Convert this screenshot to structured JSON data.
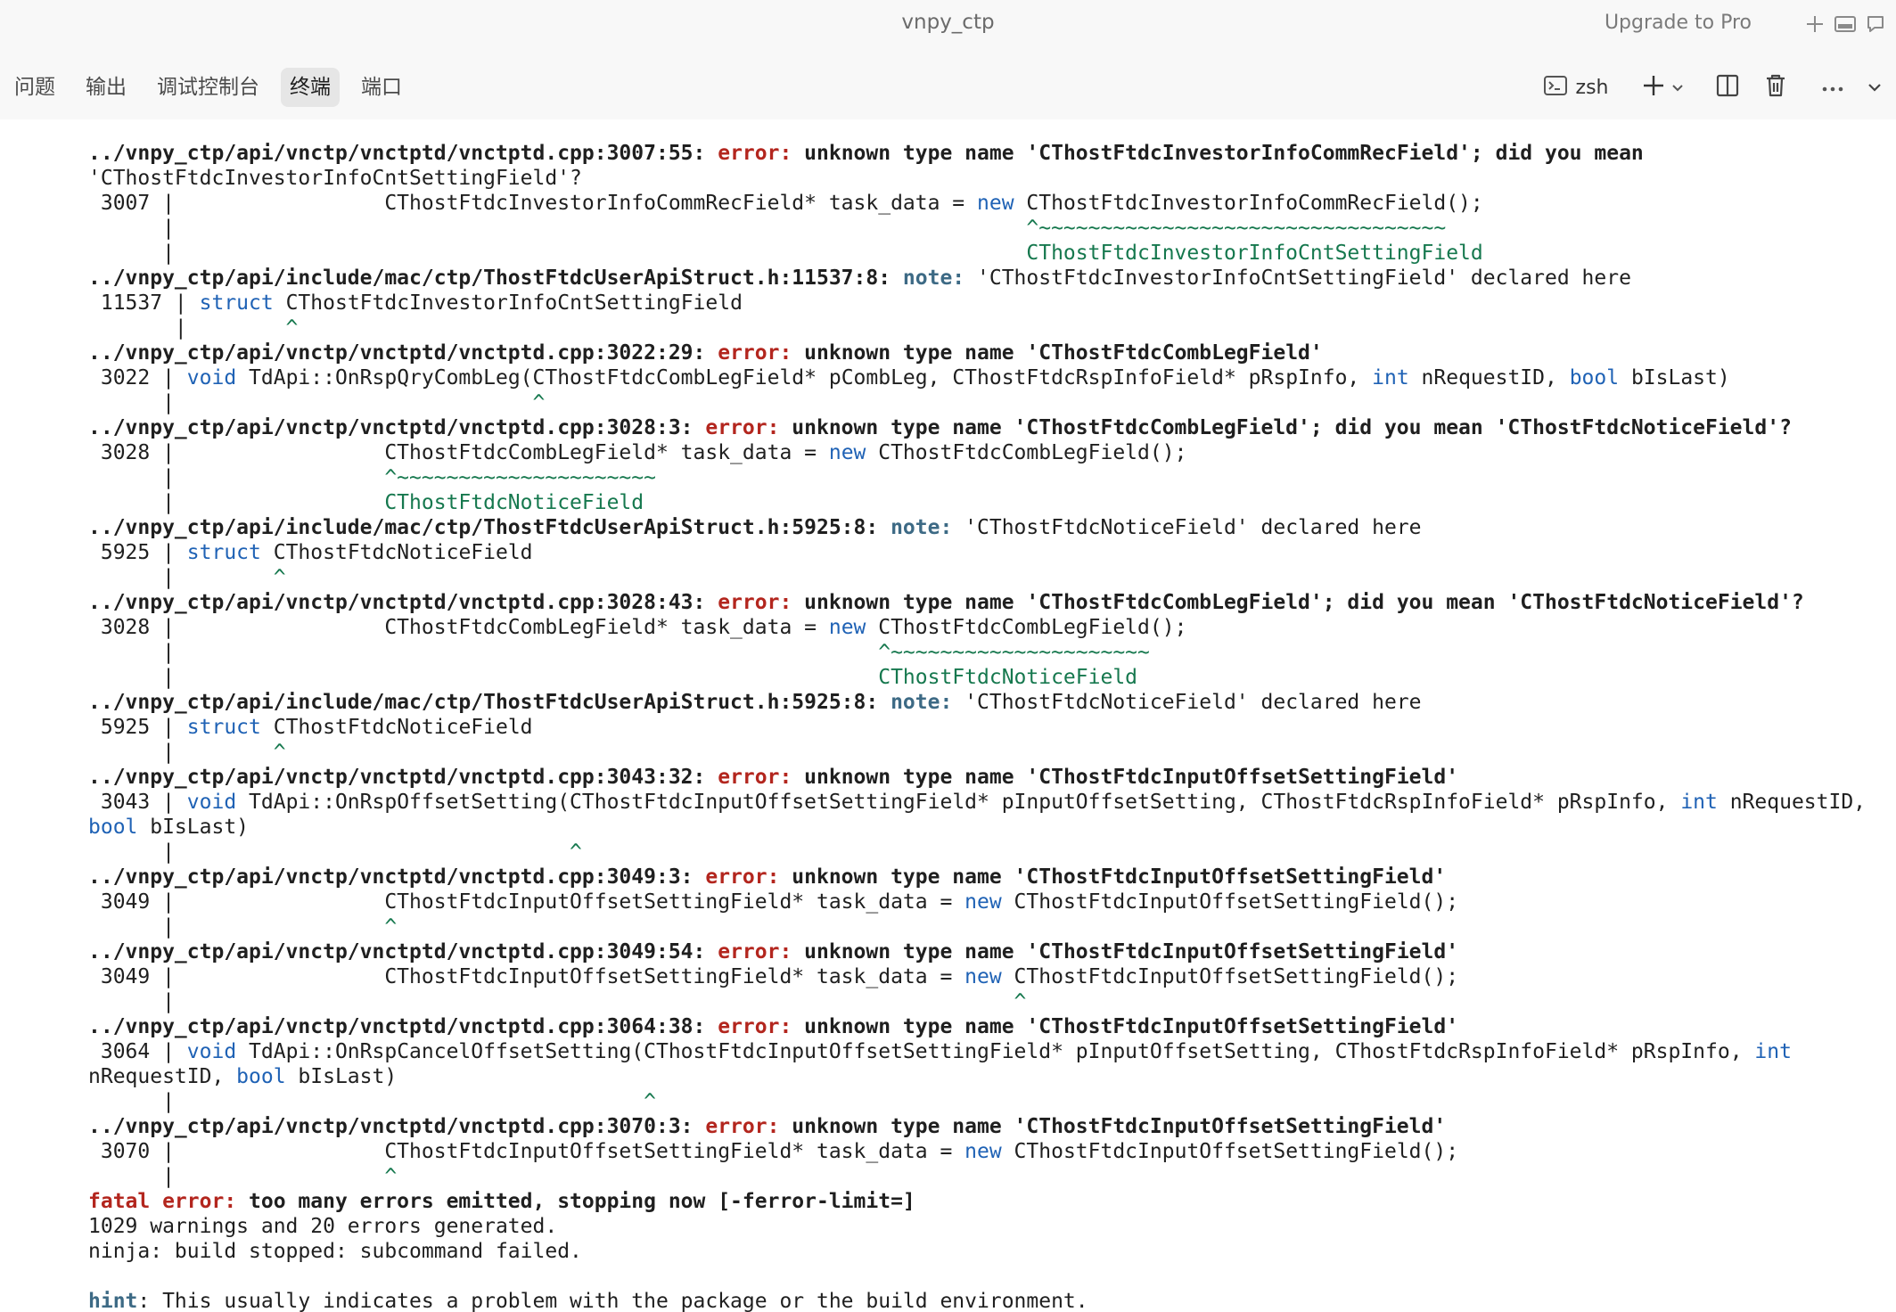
{
  "window": {
    "title": "vnpy_ctp",
    "upgrade_label": "Upgrade to Pro"
  },
  "panel": {
    "tabs": [
      {
        "label": "问题"
      },
      {
        "label": "输出"
      },
      {
        "label": "调试控制台"
      },
      {
        "label": "终端"
      },
      {
        "label": "端口"
      }
    ],
    "active_tab": "终端",
    "shell_name": "zsh"
  },
  "terminal": {
    "lines": [
      "../vnpy_ctp/api/vnctp/vnctptd/vnctptd.cpp:3007:55: error: unknown type name 'CThostFtdcInvestorInfoCommRecField'; did you mean",
      "'CThostFtdcInvestorInfoCntSettingField'?",
      " 3007 |                 CThostFtdcInvestorInfoCommRecField* task_data = new CThostFtdcInvestorInfoCommRecField();",
      "      |                                                                     ^~~~~~~~~~~~~~~~~~~~~~~~~~~~~~~~~~",
      "      |                                                                     CThostFtdcInvestorInfoCntSettingField",
      "../vnpy_ctp/api/include/mac/ctp/ThostFtdcUserApiStruct.h:11537:8: note: 'CThostFtdcInvestorInfoCntSettingField' declared here",
      " 11537 | struct CThostFtdcInvestorInfoCntSettingField",
      "       |        ^",
      "../vnpy_ctp/api/vnctp/vnctptd/vnctptd.cpp:3022:29: error: unknown type name 'CThostFtdcCombLegField'",
      " 3022 | void TdApi::OnRspQryCombLeg(CThostFtdcCombLegField* pCombLeg, CThostFtdcRspInfoField* pRspInfo, int nRequestID, bool bIsLast)",
      "      |                             ^",
      "../vnpy_ctp/api/vnctp/vnctptd/vnctptd.cpp:3028:3: error: unknown type name 'CThostFtdcCombLegField'; did you mean 'CThostFtdcNoticeField'?",
      " 3028 |                 CThostFtdcCombLegField* task_data = new CThostFtdcCombLegField();",
      "      |                 ^~~~~~~~~~~~~~~~~~~~~~",
      "      |                 CThostFtdcNoticeField",
      "../vnpy_ctp/api/include/mac/ctp/ThostFtdcUserApiStruct.h:5925:8: note: 'CThostFtdcNoticeField' declared here",
      " 5925 | struct CThostFtdcNoticeField",
      "      |        ^",
      "../vnpy_ctp/api/vnctp/vnctptd/vnctptd.cpp:3028:43: error: unknown type name 'CThostFtdcCombLegField'; did you mean 'CThostFtdcNoticeField'?",
      " 3028 |                 CThostFtdcCombLegField* task_data = new CThostFtdcCombLegField();",
      "      |                                                         ^~~~~~~~~~~~~~~~~~~~~~",
      "      |                                                         CThostFtdcNoticeField",
      "../vnpy_ctp/api/include/mac/ctp/ThostFtdcUserApiStruct.h:5925:8: note: 'CThostFtdcNoticeField' declared here",
      " 5925 | struct CThostFtdcNoticeField",
      "      |        ^",
      "../vnpy_ctp/api/vnctp/vnctptd/vnctptd.cpp:3043:32: error: unknown type name 'CThostFtdcInputOffsetSettingField'",
      " 3043 | void TdApi::OnRspOffsetSetting(CThostFtdcInputOffsetSettingField* pInputOffsetSetting, CThostFtdcRspInfoField* pRspInfo, int nRequestID,",
      "bool bIsLast)",
      "      |                                ^",
      "../vnpy_ctp/api/vnctp/vnctptd/vnctptd.cpp:3049:3: error: unknown type name 'CThostFtdcInputOffsetSettingField'",
      " 3049 |                 CThostFtdcInputOffsetSettingField* task_data = new CThostFtdcInputOffsetSettingField();",
      "      |                 ^",
      "../vnpy_ctp/api/vnctp/vnctptd/vnctptd.cpp:3049:54: error: unknown type name 'CThostFtdcInputOffsetSettingField'",
      " 3049 |                 CThostFtdcInputOffsetSettingField* task_data = new CThostFtdcInputOffsetSettingField();",
      "      |                                                                    ^",
      "../vnpy_ctp/api/vnctp/vnctptd/vnctptd.cpp:3064:38: error: unknown type name 'CThostFtdcInputOffsetSettingField'",
      " 3064 | void TdApi::OnRspCancelOffsetSetting(CThostFtdcInputOffsetSettingField* pInputOffsetSetting, CThostFtdcRspInfoField* pRspInfo, int",
      "nRequestID, bool bIsLast)",
      "      |                                      ^",
      "../vnpy_ctp/api/vnctp/vnctptd/vnctptd.cpp:3070:3: error: unknown type name 'CThostFtdcInputOffsetSettingField'",
      " 3070 |                 CThostFtdcInputOffsetSettingField* task_data = new CThostFtdcInputOffsetSettingField();",
      "      |                 ^",
      "fatal error: too many errors emitted, stopping now [-ferror-limit=]",
      "1029 warnings and 20 errors generated.",
      "ninja: build stopped: subcommand failed.",
      "",
      "hint: This usually indicates a problem with the package or the build environment."
    ]
  },
  "colors": {
    "error": "#b3261e",
    "note": "#3d6a85",
    "keyword": "#1f62b5",
    "fixit": "#16784e"
  },
  "icons": {
    "new": "plus-icon",
    "maximize": "maximize-icon",
    "chat": "chat-icon",
    "terminal": "terminal-icon",
    "add_terminal": "plus-icon",
    "split": "split-icon",
    "kill": "trash-icon",
    "more": "ellipsis-icon",
    "collapse": "chevron-down-icon"
  }
}
